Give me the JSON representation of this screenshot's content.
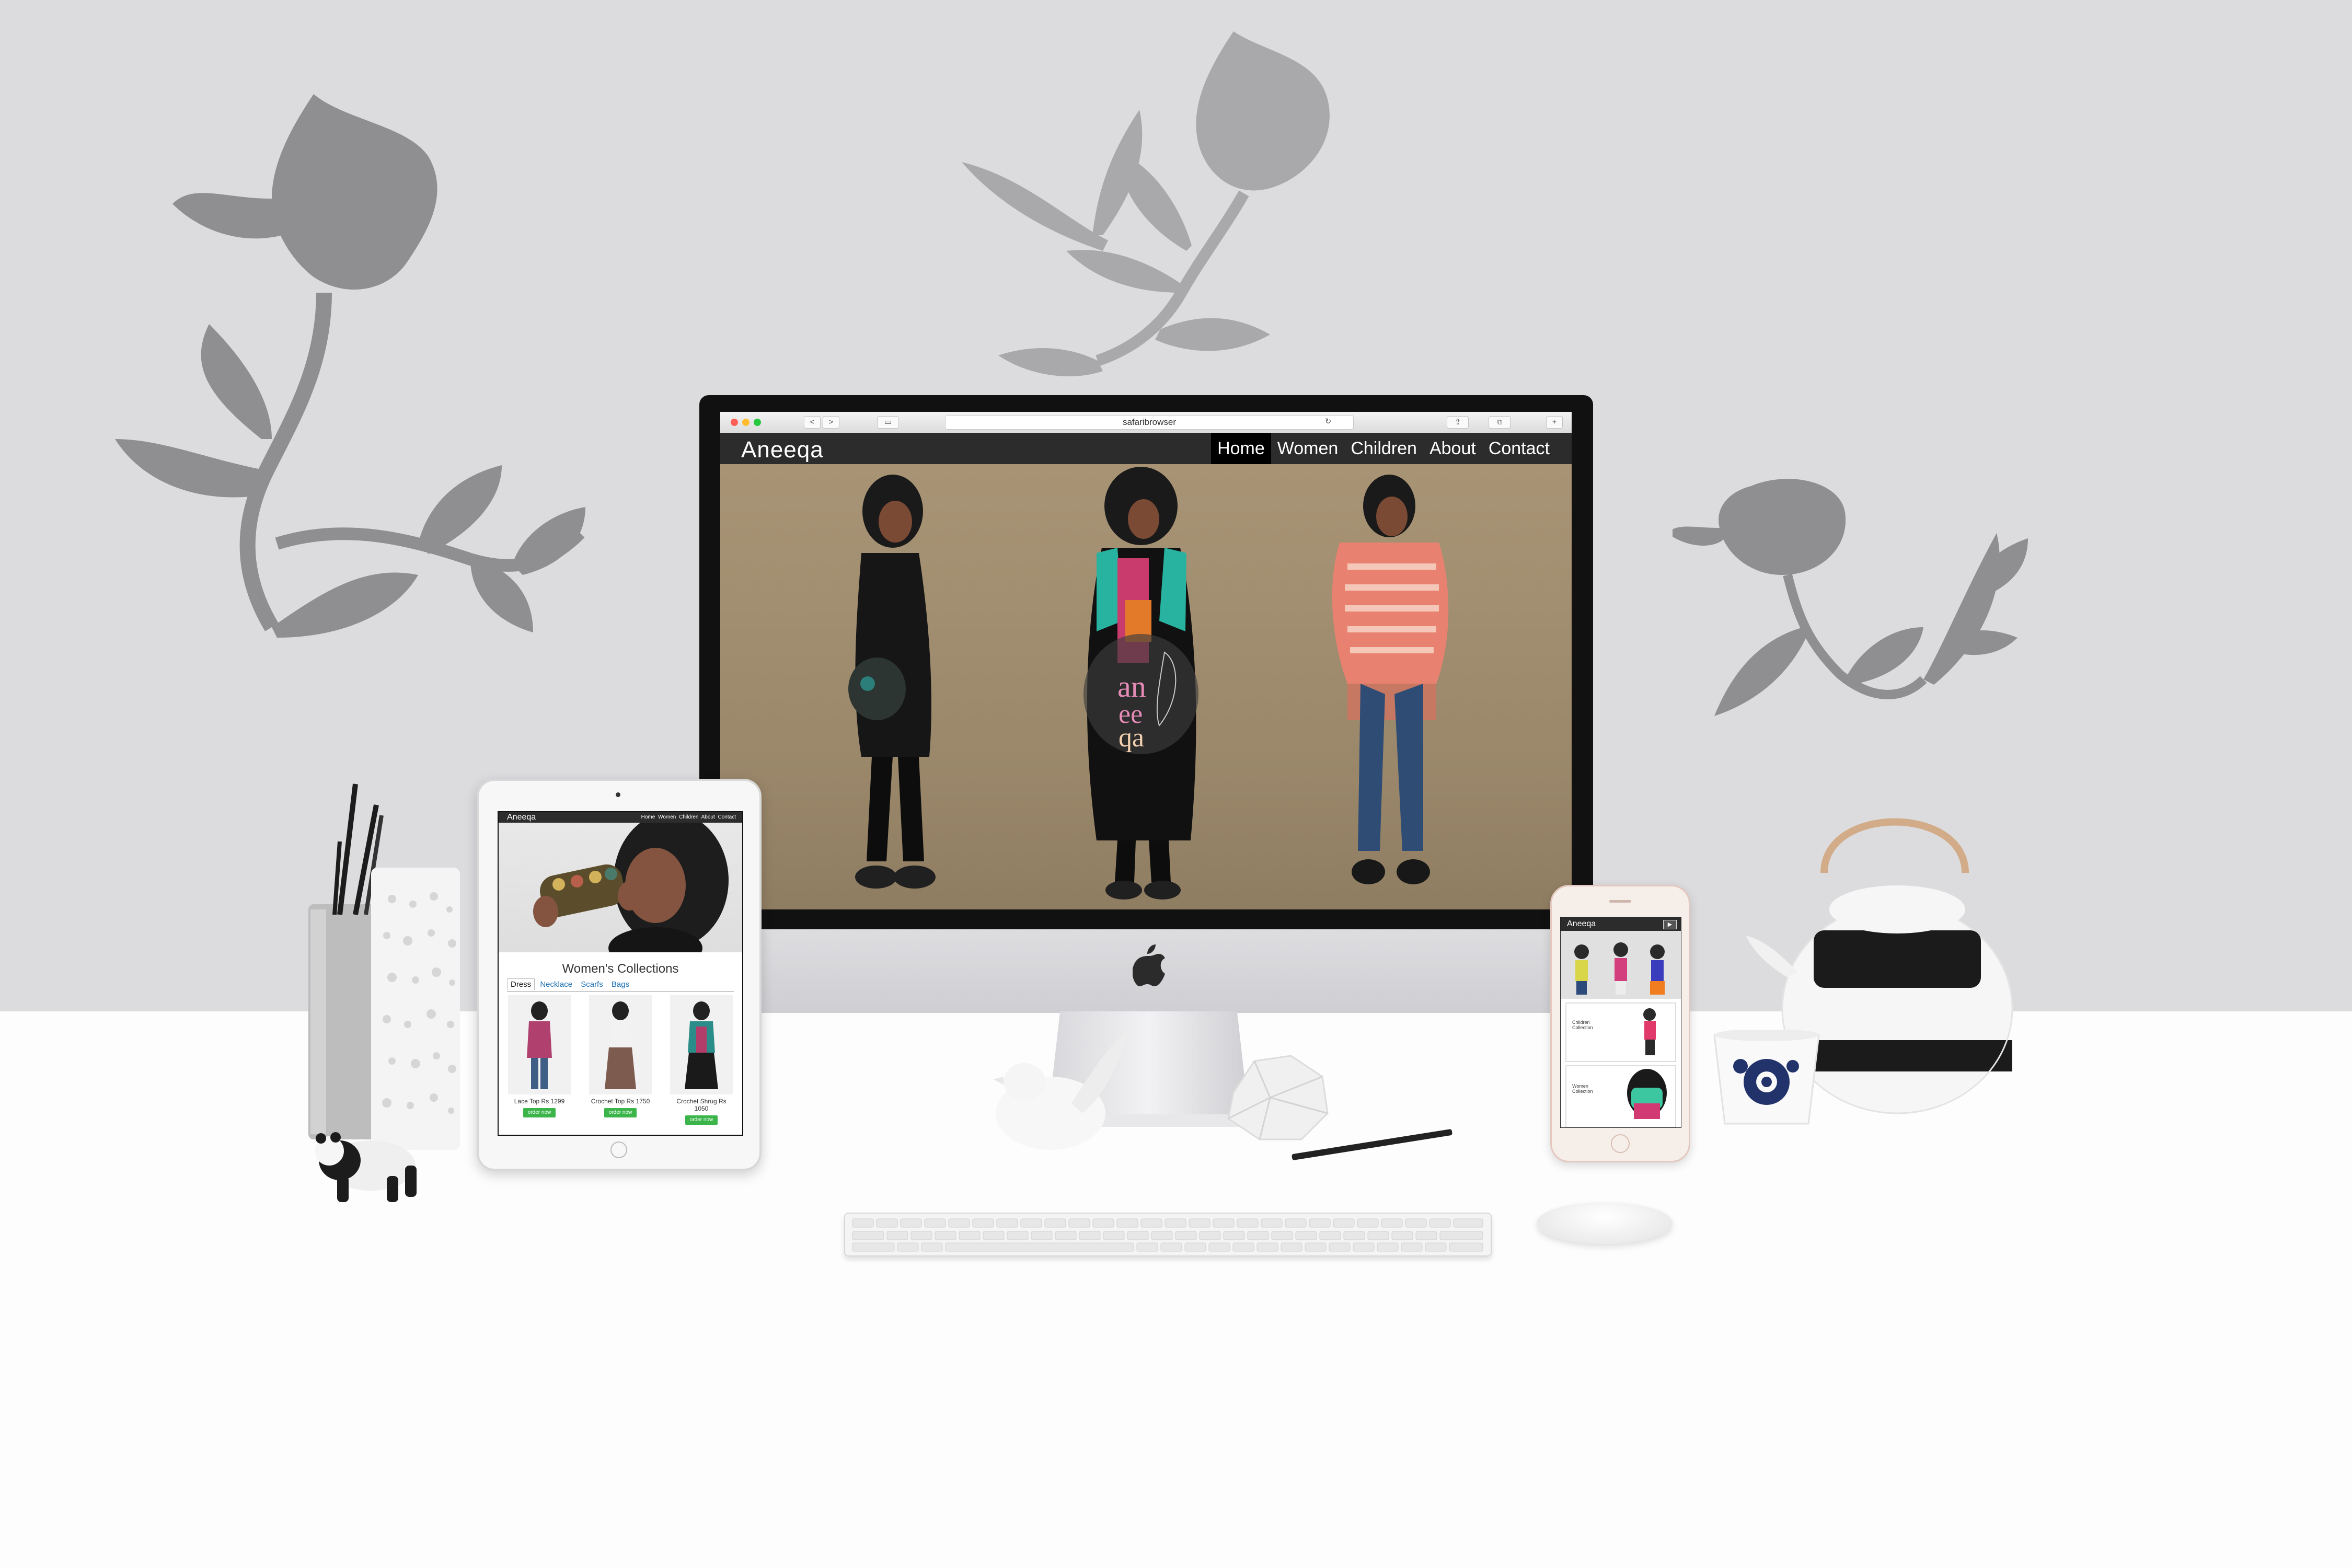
{
  "browser": {
    "url": "safaribrowser",
    "nav_back": "<",
    "nav_forward": ">"
  },
  "desktop_site": {
    "brand": "Aneeqa",
    "menu": [
      "Home",
      "Women",
      "Children",
      "About",
      "Contact"
    ],
    "active_menu": "Home"
  },
  "tablet_site": {
    "brand": "Aneeqa",
    "menu": "Home Women Children About Contact",
    "section_title": "Women's Collections",
    "tabs": [
      "Dress",
      "Necklace",
      "Scarfs",
      "Bags"
    ],
    "products": [
      {
        "caption": "Lace Top Rs 1299",
        "button": "order now"
      },
      {
        "caption": "Crochet Top Rs 1750",
        "button": "order now"
      },
      {
        "caption": "Crochet Shrug Rs 1050",
        "button": "order now"
      }
    ]
  },
  "phone_site": {
    "brand": "Aneeqa",
    "menu_icon": "▶",
    "cards": [
      {
        "label": "Children Collection"
      },
      {
        "label": "Women Collection"
      }
    ]
  },
  "colors": {
    "wall": "#dcdcdf",
    "nav": "#2c2c2c",
    "order_button": "#3bb54a",
    "link": "#1c6fb2"
  },
  "icons": [
    "apple-logo-icon",
    "menu-icon"
  ]
}
